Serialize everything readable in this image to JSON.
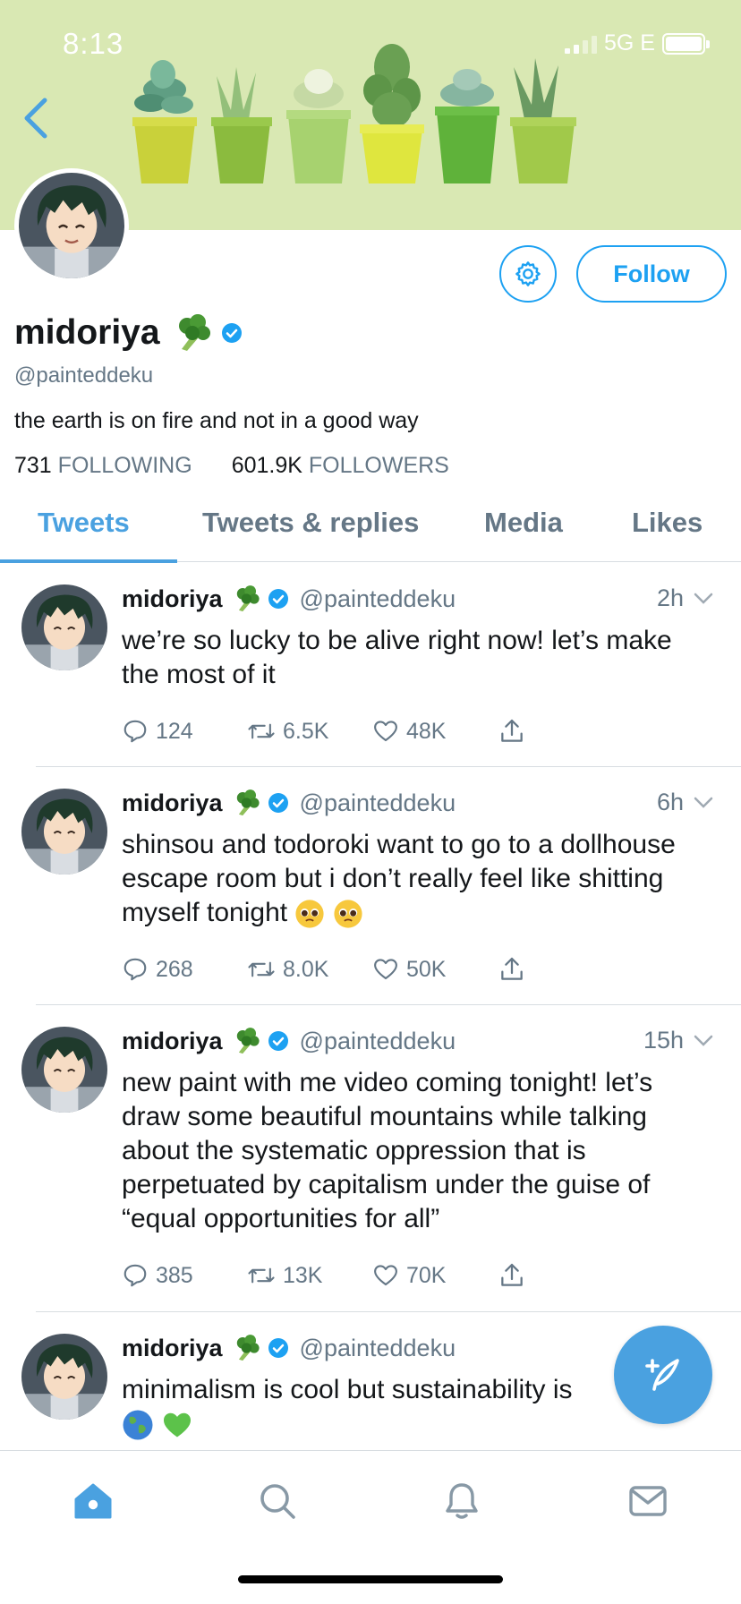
{
  "status_bar": {
    "time": "8:13",
    "network": "5G E"
  },
  "profile": {
    "name": "midoriya",
    "handle": "@painteddeku",
    "bio": "the earth is on fire and not in a good way",
    "following_count": "731",
    "following_label": "FOLLOWING",
    "followers_count": "601.9K",
    "followers_label": "FOLLOWERS",
    "follow_label": "Follow"
  },
  "tabs": [
    {
      "label": "Tweets",
      "active": true
    },
    {
      "label": "Tweets & replies",
      "active": false
    },
    {
      "label": "Media",
      "active": false
    },
    {
      "label": "Likes",
      "active": false
    }
  ],
  "tweets": [
    {
      "name": "midoriya",
      "handle": "@painteddeku",
      "time": "2h",
      "text": "we’re so lucky to be alive right now! let’s make the most of it",
      "replies": "124",
      "retweets": "6.5K",
      "likes": "48K"
    },
    {
      "name": "midoriya",
      "handle": "@painteddeku",
      "time": "6h",
      "text": "shinsou and todoroki want to go to a dollhouse escape room but i don’t really feel like shitting myself tonight",
      "replies": "268",
      "retweets": "8.0K",
      "likes": "50K"
    },
    {
      "name": "midoriya",
      "handle": "@painteddeku",
      "time": "15h",
      "text": "new paint with me video coming tonight! let’s draw some beautiful mountains while talking about the systematic oppression that is perpetuated by capitalism under the guise of “equal opportunities for all”",
      "replies": "385",
      "retweets": "13K",
      "likes": "70K"
    },
    {
      "name": "midoriya",
      "handle": "@painteddeku",
      "time": "",
      "text": "minimalism is cool but sustainability is"
    }
  ],
  "icons": {
    "back": "chevron-left-icon",
    "settings": "gear-icon",
    "verified": "verified-badge-icon",
    "broccoli": "broccoli-emoji",
    "compose": "compose-tweet-icon",
    "nav": [
      "home-icon",
      "search-icon",
      "notifications-icon",
      "messages-icon"
    ]
  },
  "colors": {
    "accent": "#1da1f2",
    "tab_active": "#4aa1e0",
    "banner": "#d9e8b3",
    "muted": "#657786"
  }
}
